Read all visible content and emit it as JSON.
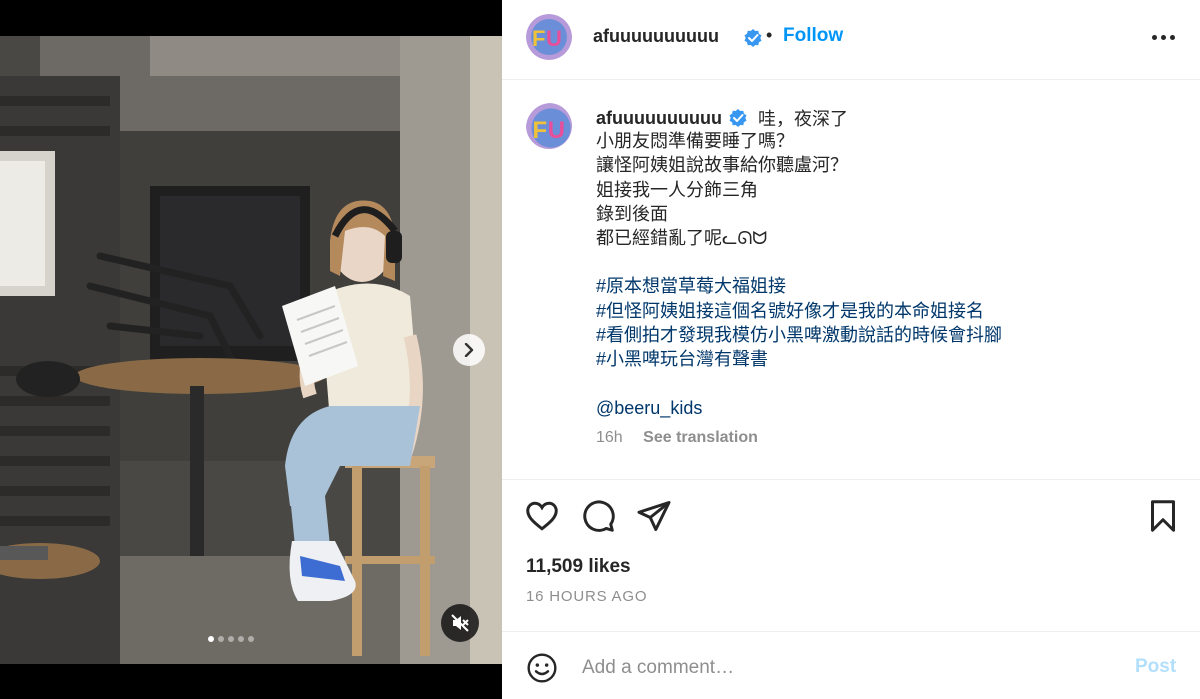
{
  "media": {
    "carousel_total": 5,
    "carousel_active": 1,
    "next_icon": "chevron-right-icon",
    "mute_icon": "speaker-muted-icon"
  },
  "header": {
    "username": "afuuuuuuuuuu",
    "verified_icon": "verified-badge-icon",
    "separator": "•",
    "follow_label": "Follow",
    "more_icon": "more-options-icon"
  },
  "caption": {
    "username": "afuuuuuuuuuu",
    "first_line": "哇，夜深了",
    "lines": [
      "小朋友悶準備要睡了嗎？",
      "讓怪阿姨姐說故事給你聽盧河？",
      "姐接我一人分飾三角",
      "錄到後面",
      "都已經錯亂了呢ᓚᘏᗢ"
    ],
    "hashtags": [
      "#原本想當草莓大福姐接",
      "#但怪阿姨姐接這個名號好像才是我的本命姐接名",
      "#看側拍才發現我模仿小黑啤激動說話的時候會抖腳",
      "#小黑啤玩台灣有聲書"
    ],
    "mention": "@beeru_kids",
    "time": "16h",
    "see_translation": "See translation"
  },
  "actions": {
    "like_icon": "heart-icon",
    "comment_icon": "comment-icon",
    "share_icon": "share-icon",
    "save_icon": "bookmark-icon",
    "likes": "11,509 likes",
    "time_ago": "16 HOURS AGO"
  },
  "comment": {
    "emoji_icon": "emoji-icon",
    "placeholder": "Add a comment…",
    "post_label": "Post"
  },
  "colors": {
    "accent": "#0095f6",
    "link": "#00376b",
    "muted": "#8e8e8e",
    "post_disabled": "#b2dffc"
  }
}
